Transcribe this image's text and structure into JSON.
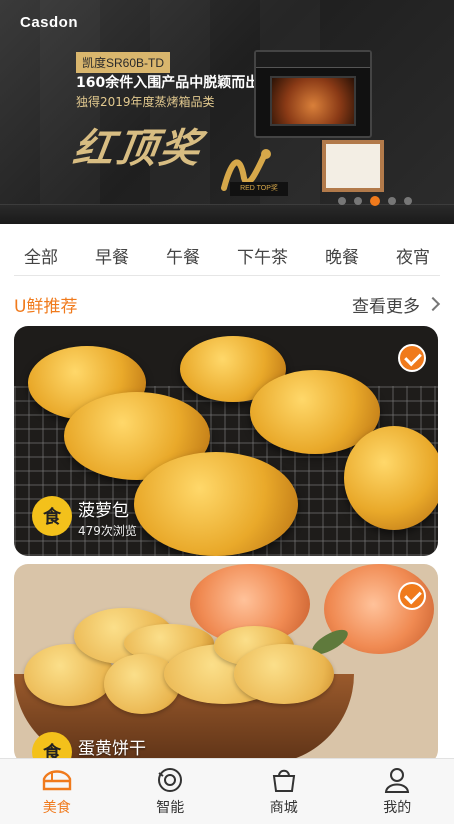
{
  "banner": {
    "logo": "Casdon",
    "model_tag": "凯度SR60B-TD",
    "headline": "160余件入围产品中脱颖而出",
    "subline": "独得2019年度蒸烤箱品类",
    "award_text": "红顶奖",
    "trophy_label": "RED TOP奖",
    "carousel_dots": 5,
    "active_dot": 3
  },
  "tabs": [
    {
      "label": "全部"
    },
    {
      "label": "早餐"
    },
    {
      "label": "午餐"
    },
    {
      "label": "下午茶"
    },
    {
      "label": "晚餐"
    },
    {
      "label": "夜宵"
    }
  ],
  "section": {
    "title": "U鲜推荐",
    "more_label": "查看更多"
  },
  "cards": [
    {
      "title": "菠萝包",
      "views": "479次浏览",
      "badge_glyph": "食"
    },
    {
      "title": "蛋黄饼干",
      "views": "",
      "badge_glyph": "食"
    }
  ],
  "nav": [
    {
      "label": "美食",
      "icon": "food-icon",
      "active": true
    },
    {
      "label": "智能",
      "icon": "smart-device-icon",
      "active": false
    },
    {
      "label": "商城",
      "icon": "shopping-bag-icon",
      "active": false
    },
    {
      "label": "我的",
      "icon": "profile-icon",
      "active": false
    }
  ],
  "colors": {
    "accent": "#f07a1c",
    "gold": "#d8bd82"
  }
}
